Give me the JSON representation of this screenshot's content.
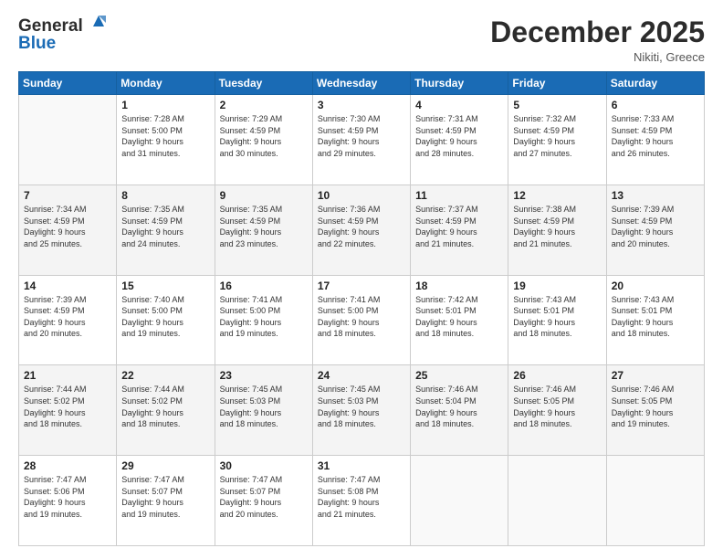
{
  "header": {
    "logo_line1": "General",
    "logo_line2": "Blue",
    "month": "December 2025",
    "location": "Nikiti, Greece"
  },
  "days_of_week": [
    "Sunday",
    "Monday",
    "Tuesday",
    "Wednesday",
    "Thursday",
    "Friday",
    "Saturday"
  ],
  "weeks": [
    [
      {
        "num": "",
        "info": ""
      },
      {
        "num": "1",
        "info": "Sunrise: 7:28 AM\nSunset: 5:00 PM\nDaylight: 9 hours\nand 31 minutes."
      },
      {
        "num": "2",
        "info": "Sunrise: 7:29 AM\nSunset: 4:59 PM\nDaylight: 9 hours\nand 30 minutes."
      },
      {
        "num": "3",
        "info": "Sunrise: 7:30 AM\nSunset: 4:59 PM\nDaylight: 9 hours\nand 29 minutes."
      },
      {
        "num": "4",
        "info": "Sunrise: 7:31 AM\nSunset: 4:59 PM\nDaylight: 9 hours\nand 28 minutes."
      },
      {
        "num": "5",
        "info": "Sunrise: 7:32 AM\nSunset: 4:59 PM\nDaylight: 9 hours\nand 27 minutes."
      },
      {
        "num": "6",
        "info": "Sunrise: 7:33 AM\nSunset: 4:59 PM\nDaylight: 9 hours\nand 26 minutes."
      }
    ],
    [
      {
        "num": "7",
        "info": "Sunrise: 7:34 AM\nSunset: 4:59 PM\nDaylight: 9 hours\nand 25 minutes."
      },
      {
        "num": "8",
        "info": "Sunrise: 7:35 AM\nSunset: 4:59 PM\nDaylight: 9 hours\nand 24 minutes."
      },
      {
        "num": "9",
        "info": "Sunrise: 7:35 AM\nSunset: 4:59 PM\nDaylight: 9 hours\nand 23 minutes."
      },
      {
        "num": "10",
        "info": "Sunrise: 7:36 AM\nSunset: 4:59 PM\nDaylight: 9 hours\nand 22 minutes."
      },
      {
        "num": "11",
        "info": "Sunrise: 7:37 AM\nSunset: 4:59 PM\nDaylight: 9 hours\nand 21 minutes."
      },
      {
        "num": "12",
        "info": "Sunrise: 7:38 AM\nSunset: 4:59 PM\nDaylight: 9 hours\nand 21 minutes."
      },
      {
        "num": "13",
        "info": "Sunrise: 7:39 AM\nSunset: 4:59 PM\nDaylight: 9 hours\nand 20 minutes."
      }
    ],
    [
      {
        "num": "14",
        "info": "Sunrise: 7:39 AM\nSunset: 4:59 PM\nDaylight: 9 hours\nand 20 minutes."
      },
      {
        "num": "15",
        "info": "Sunrise: 7:40 AM\nSunset: 5:00 PM\nDaylight: 9 hours\nand 19 minutes."
      },
      {
        "num": "16",
        "info": "Sunrise: 7:41 AM\nSunset: 5:00 PM\nDaylight: 9 hours\nand 19 minutes."
      },
      {
        "num": "17",
        "info": "Sunrise: 7:41 AM\nSunset: 5:00 PM\nDaylight: 9 hours\nand 18 minutes."
      },
      {
        "num": "18",
        "info": "Sunrise: 7:42 AM\nSunset: 5:01 PM\nDaylight: 9 hours\nand 18 minutes."
      },
      {
        "num": "19",
        "info": "Sunrise: 7:43 AM\nSunset: 5:01 PM\nDaylight: 9 hours\nand 18 minutes."
      },
      {
        "num": "20",
        "info": "Sunrise: 7:43 AM\nSunset: 5:01 PM\nDaylight: 9 hours\nand 18 minutes."
      }
    ],
    [
      {
        "num": "21",
        "info": "Sunrise: 7:44 AM\nSunset: 5:02 PM\nDaylight: 9 hours\nand 18 minutes."
      },
      {
        "num": "22",
        "info": "Sunrise: 7:44 AM\nSunset: 5:02 PM\nDaylight: 9 hours\nand 18 minutes."
      },
      {
        "num": "23",
        "info": "Sunrise: 7:45 AM\nSunset: 5:03 PM\nDaylight: 9 hours\nand 18 minutes."
      },
      {
        "num": "24",
        "info": "Sunrise: 7:45 AM\nSunset: 5:03 PM\nDaylight: 9 hours\nand 18 minutes."
      },
      {
        "num": "25",
        "info": "Sunrise: 7:46 AM\nSunset: 5:04 PM\nDaylight: 9 hours\nand 18 minutes."
      },
      {
        "num": "26",
        "info": "Sunrise: 7:46 AM\nSunset: 5:05 PM\nDaylight: 9 hours\nand 18 minutes."
      },
      {
        "num": "27",
        "info": "Sunrise: 7:46 AM\nSunset: 5:05 PM\nDaylight: 9 hours\nand 19 minutes."
      }
    ],
    [
      {
        "num": "28",
        "info": "Sunrise: 7:47 AM\nSunset: 5:06 PM\nDaylight: 9 hours\nand 19 minutes."
      },
      {
        "num": "29",
        "info": "Sunrise: 7:47 AM\nSunset: 5:07 PM\nDaylight: 9 hours\nand 19 minutes."
      },
      {
        "num": "30",
        "info": "Sunrise: 7:47 AM\nSunset: 5:07 PM\nDaylight: 9 hours\nand 20 minutes."
      },
      {
        "num": "31",
        "info": "Sunrise: 7:47 AM\nSunset: 5:08 PM\nDaylight: 9 hours\nand 21 minutes."
      },
      {
        "num": "",
        "info": ""
      },
      {
        "num": "",
        "info": ""
      },
      {
        "num": "",
        "info": ""
      }
    ]
  ]
}
